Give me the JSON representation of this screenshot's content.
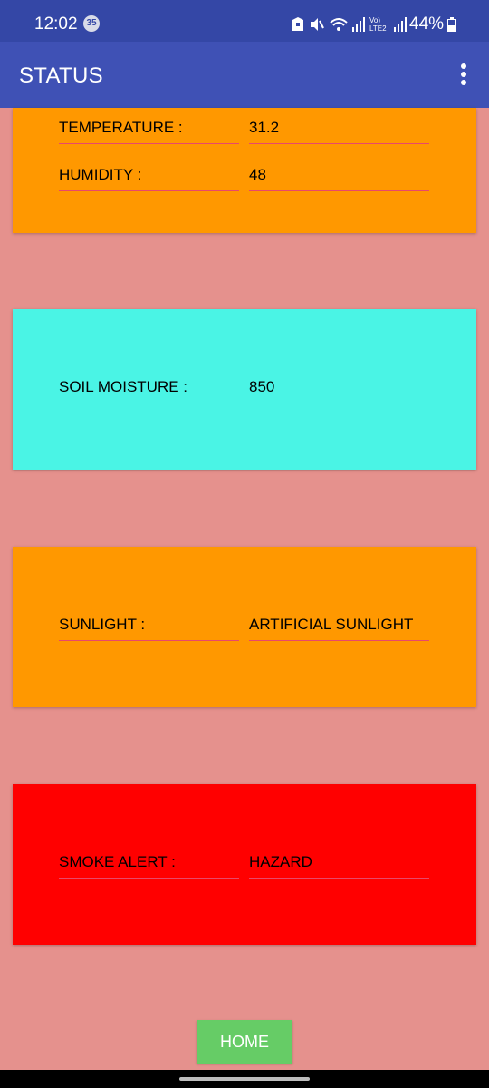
{
  "status_bar": {
    "time": "12:02",
    "notification_count": "35",
    "network_label": "Vo) LTE2",
    "battery": "44%"
  },
  "app_bar": {
    "title": "STATUS",
    "menu_icon": "more-vert-icon"
  },
  "cards": {
    "environment": {
      "color": "#ff9800",
      "temperature_label": "TEMPERATURE :",
      "temperature_value": "31.2",
      "humidity_label": "HUMIDITY :",
      "humidity_value": "48"
    },
    "soil": {
      "color": "#4af4e5",
      "label": "SOIL MOISTURE :",
      "value": "850"
    },
    "sunlight": {
      "color": "#ff9800",
      "label": "SUNLIGHT :",
      "value": "ARTIFICIAL SUNLIGHT"
    },
    "smoke": {
      "color": "#ff0000",
      "label": "SMOKE ALERT :",
      "value": "HAZARD"
    }
  },
  "home_button": {
    "label": "HOME"
  },
  "colors": {
    "background": "#e5918d",
    "app_bar": "#3f51b5",
    "status_bar": "#3447a6",
    "home_button": "#66cc66",
    "field_underline": "#e8486a"
  }
}
